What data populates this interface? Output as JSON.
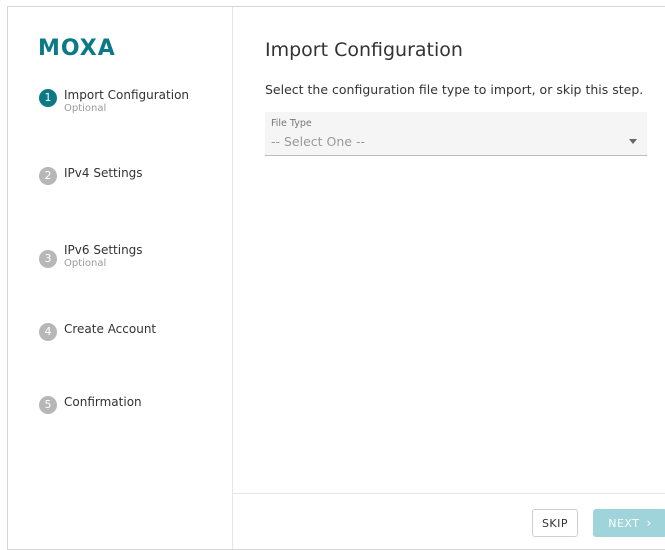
{
  "brand": {
    "name": "MOXA",
    "color": "#0b7a86"
  },
  "steps": [
    {
      "number": "1",
      "label": "Import Configuration",
      "sub": "Optional",
      "active": true
    },
    {
      "number": "2",
      "label": "IPv4 Settings",
      "sub": ""
    },
    {
      "number": "3",
      "label": "IPv6 Settings",
      "sub": "Optional"
    },
    {
      "number": "4",
      "label": "Create Account",
      "sub": ""
    },
    {
      "number": "5",
      "label": "Confirmation",
      "sub": ""
    }
  ],
  "main": {
    "title": "Import Configuration",
    "instructions": "Select the configuration file type to import, or skip this step.",
    "file_type": {
      "label": "File Type",
      "value": "-- Select One --",
      "icon": "caret-down-icon"
    }
  },
  "footer": {
    "skip_label": "SKIP",
    "next_label": "NEXT",
    "next_icon": "chevron-right-icon",
    "next_disabled_color": "#9fd5da"
  },
  "colors": {
    "accent": "#0b7a86",
    "inactive_step": "#b7b7b7"
  }
}
